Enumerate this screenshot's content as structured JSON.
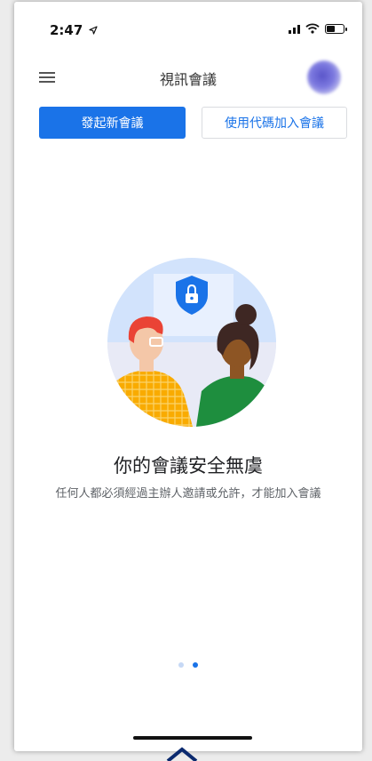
{
  "status_bar": {
    "time": "2:47"
  },
  "app_bar": {
    "title": "視訊會議"
  },
  "actions": {
    "new_meeting": "發起新會議",
    "join_with_code": "使用代碼加入會議"
  },
  "onboarding": {
    "headline": "你的會議安全無虞",
    "description": "任何人都必須經過主辦人邀請或允許，才能加入會議",
    "pages_total": 2,
    "current_page": 2
  },
  "colors": {
    "primary": "#1a73e8",
    "shield": "#1a73e8",
    "illustration_bg": "#d2e3fc"
  },
  "icons": [
    "menu-icon",
    "location-arrow-icon",
    "signal-icon",
    "wifi-icon",
    "battery-icon",
    "shield-lock-icon",
    "chevron-up-icon"
  ]
}
